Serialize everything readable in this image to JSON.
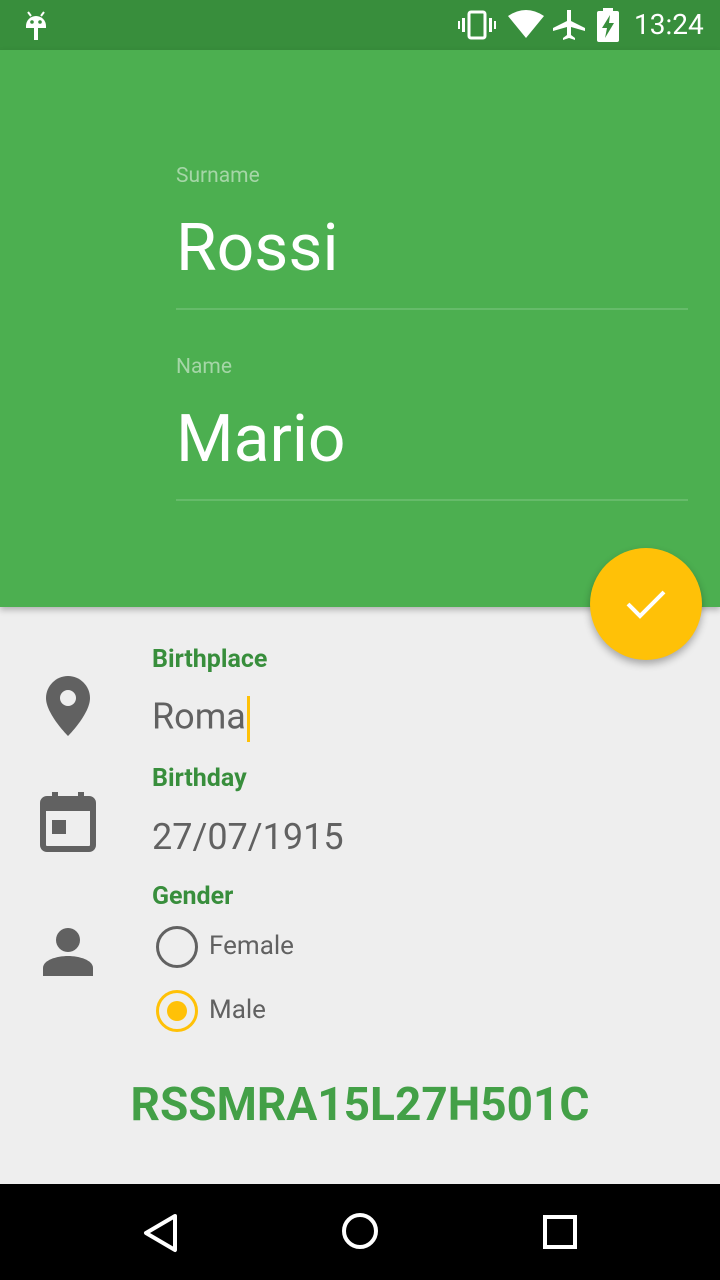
{
  "status_bar": {
    "time": "13:24",
    "icons": [
      "android-icon",
      "vibrate-icon",
      "wifi-icon",
      "airplane-icon",
      "battery-charging-icon"
    ]
  },
  "header": {
    "surname": {
      "label": "Surname",
      "value": "Rossi"
    },
    "name": {
      "label": "Name",
      "value": "Mario"
    }
  },
  "fab": {
    "icon": "check-icon"
  },
  "form": {
    "birthplace": {
      "label": "Birthplace",
      "value": "Roma",
      "icon": "location-pin-icon"
    },
    "birthday": {
      "label": "Birthday",
      "value": "27/07/1915",
      "icon": "calendar-icon"
    },
    "gender": {
      "label": "Gender",
      "icon": "person-icon",
      "options": [
        {
          "label": "Female",
          "checked": false
        },
        {
          "label": "Male",
          "checked": true
        }
      ]
    }
  },
  "fiscal_code": "RSSMRA15L27H501C",
  "colors": {
    "status_bar": "#388e3c",
    "primary": "#4caf50",
    "accent": "#ffc107",
    "label_green": "#388e3c",
    "fiscal_code": "#43a047",
    "background": "#eeeeee"
  },
  "nav_bar": {
    "icons": [
      "back-icon",
      "home-icon",
      "recents-icon"
    ]
  }
}
